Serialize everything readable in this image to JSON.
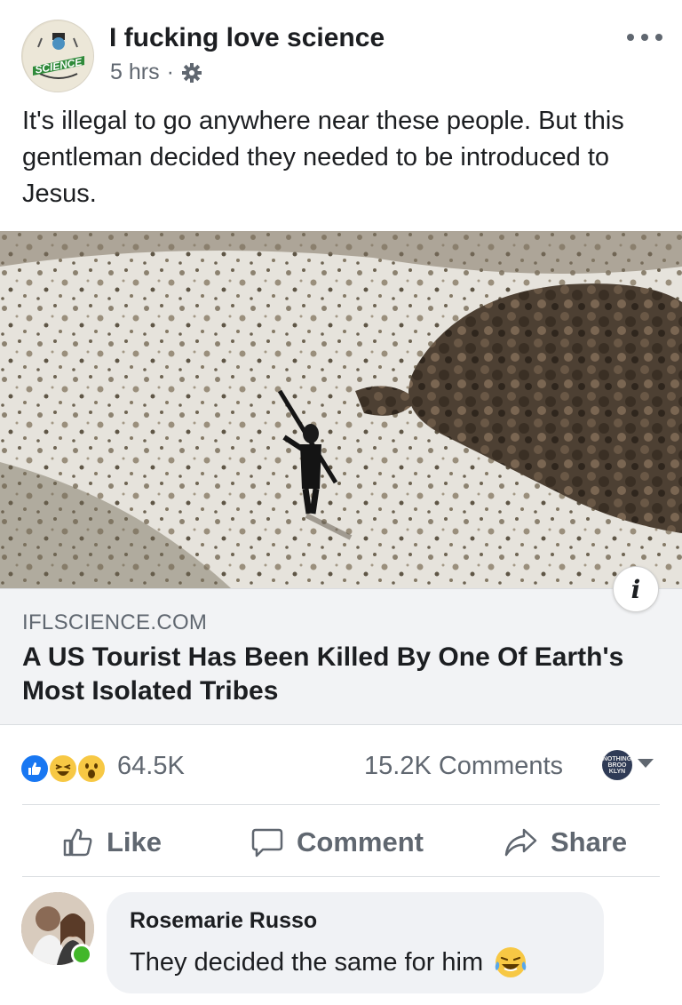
{
  "post": {
    "page_name": "I fucking love science",
    "time": "5 hrs",
    "separator": "·",
    "privacy_icon": "gear-icon",
    "text": "It's illegal to go anywhere near these people. But this gentleman decided they needed to be introduced to Jesus.",
    "avatar_text": "SCIENCE"
  },
  "link": {
    "domain": "IFLSCIENCE.COM",
    "title": "A US Tourist Has Been Killed By One Of Earth's Most Isolated Tribes",
    "info_label": "i"
  },
  "engagement": {
    "reactions": [
      "like",
      "haha",
      "wow"
    ],
    "reaction_count": "64.5K",
    "comments_count": "15.2K Comments",
    "viewer_avatar_text": "NOTHING BROO KLYN"
  },
  "actions": {
    "like": "Like",
    "comment": "Comment",
    "share": "Share"
  },
  "comment": {
    "author": "Rosemarie Russo",
    "text": "They decided the same for him",
    "emoji": "face-with-tears-of-joy"
  },
  "colors": {
    "text_primary": "#1c1e21",
    "text_secondary": "#606770",
    "link_box_bg": "#f2f3f5",
    "like_blue": "#1877f2",
    "online_green": "#42b72a"
  }
}
